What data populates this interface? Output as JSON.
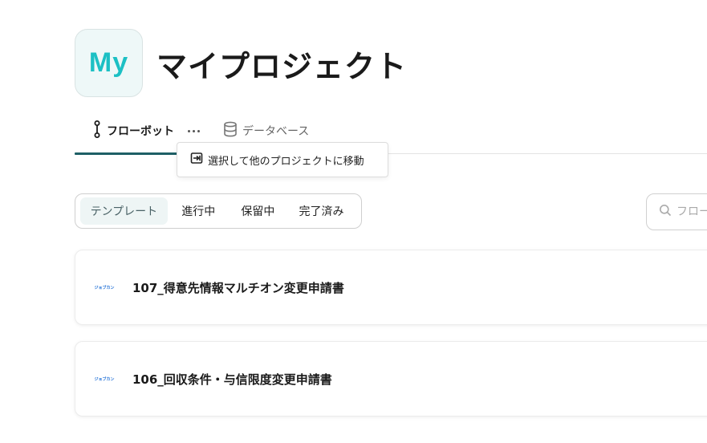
{
  "project": {
    "avatar_text": "My",
    "title": "マイプロジェクト"
  },
  "tabs": [
    {
      "label": "フローボット",
      "icon": "flow-icon",
      "active": true
    },
    {
      "label": "データベース",
      "icon": "database-icon",
      "active": false
    }
  ],
  "tab_more_icon": "ellipsis-icon",
  "popover": {
    "icon": "move-to-icon",
    "label": "選択して他のプロジェクトに移動"
  },
  "filters": [
    {
      "label": "テンプレート",
      "active": true
    },
    {
      "label": "進行中",
      "active": false
    },
    {
      "label": "保留中",
      "active": false
    },
    {
      "label": "完了済み",
      "active": false
    }
  ],
  "search": {
    "placeholder": "フロー"
  },
  "flowbots": [
    {
      "logo_text": "ジョブカン",
      "title": "107_得意先情報マルチオン変更申請書"
    },
    {
      "logo_text": "ジョブカン",
      "title": "106_回収条件・与信限度変更申請書"
    }
  ],
  "colors": {
    "accent": "#1e5f66",
    "avatar_text": "#1cc0c4",
    "avatar_bg": "#eef8f8",
    "active_filter_bg": "#eef5f5",
    "logo_blue": "#1f6fd6"
  }
}
